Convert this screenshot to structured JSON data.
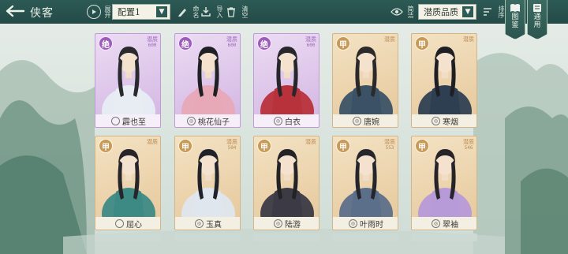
{
  "header": {
    "title": "侠客",
    "config_select": "配置1",
    "config_tools": [
      {
        "label": "命名",
        "icon": "pencil-icon"
      },
      {
        "label": "导入",
        "icon": "import-icon"
      },
      {
        "label": "清空",
        "icon": "trash-icon"
      }
    ],
    "display_label": "简洁",
    "sort_select": "潜质品质",
    "sort_order_label": "排序",
    "play_label": "展开"
  },
  "side_tabs": [
    {
      "label": "图鉴",
      "icon": "book-icon"
    },
    {
      "label": "通用",
      "icon": "scroll-icon"
    }
  ],
  "cards": [
    {
      "name": "霹也至",
      "grade": "绝",
      "tier": "purple",
      "potential_label": "潜质",
      "potential_value": "600",
      "sect_icon": ""
    },
    {
      "name": "桃花仙子",
      "grade": "绝",
      "tier": "purple",
      "potential_label": "潜质",
      "potential_value": "600",
      "sect_icon": "◎"
    },
    {
      "name": "白衣",
      "grade": "绝",
      "tier": "purple",
      "potential_label": "潜质",
      "potential_value": "600",
      "sect_icon": "◎"
    },
    {
      "name": "唐婉",
      "grade": "甲",
      "tier": "gold",
      "potential_label": "潜质",
      "potential_value": "",
      "sect_icon": "◎"
    },
    {
      "name": "寒烟",
      "grade": "甲",
      "tier": "gold",
      "potential_label": "潜质",
      "potential_value": "",
      "sect_icon": "◎"
    },
    {
      "name": "屈心",
      "grade": "甲",
      "tier": "gold",
      "potential_label": "潜质",
      "potential_value": "",
      "sect_icon": ""
    },
    {
      "name": "玉真",
      "grade": "甲",
      "tier": "gold",
      "potential_label": "潜质",
      "potential_value": "504",
      "sect_icon": "◎"
    },
    {
      "name": "陆游",
      "grade": "甲",
      "tier": "gold",
      "potential_label": "潜质",
      "potential_value": "",
      "sect_icon": "◎"
    },
    {
      "name": "叶雨时",
      "grade": "甲",
      "tier": "gold",
      "potential_label": "潜质",
      "potential_value": "553",
      "sect_icon": "◎"
    },
    {
      "name": "翠袖",
      "grade": "甲",
      "tier": "gold",
      "potential_label": "潜质",
      "potential_value": "546",
      "sect_icon": "◎"
    }
  ],
  "colors": {
    "header_bg": "#2d5a55",
    "gold_card": "#e6c79a",
    "purple_card": "#d2b4e2"
  }
}
